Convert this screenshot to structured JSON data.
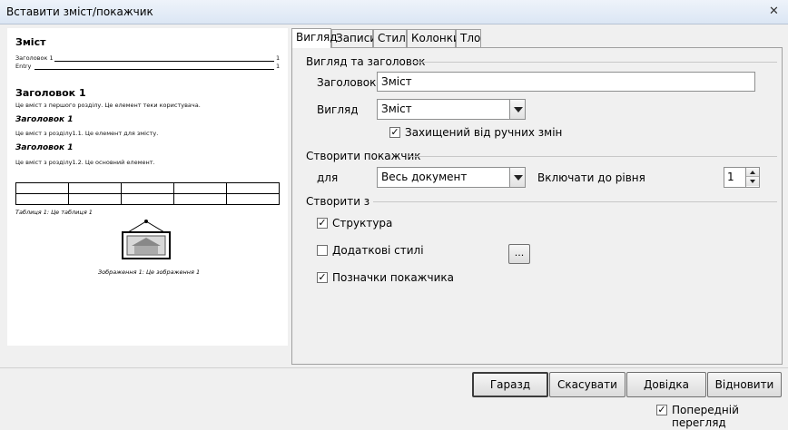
{
  "window": {
    "title": "Вставити зміст/покажчик",
    "close_glyph": "✕"
  },
  "preview": {
    "toc_title": "Зміст",
    "toc_entries": [
      {
        "label": "Заголовок 1",
        "page": "1"
      },
      {
        "label": "Entry",
        "page": "1"
      }
    ],
    "heading1": "Заголовок 1",
    "heading1_text": "Це вміст з першого розділу. Це елемент теки користувача.",
    "heading1_1": "Заголовок 1",
    "heading1_1_text": "Це вміст з розділу1.1. Це елемент для змісту.",
    "heading1_2": "Заголовок 1",
    "heading1_2_text": "Це вміст з розділу1.2. Це основний елемент.",
    "table_caption": "Таблиця 1: Це таблиця 1",
    "image_caption": "Зображення 1: Це зображення 1"
  },
  "tabs": [
    {
      "label": "Вигляд",
      "active": true
    },
    {
      "label": "Записи",
      "active": false
    },
    {
      "label": "Стилі",
      "active": false
    },
    {
      "label": "Колонки",
      "active": false
    },
    {
      "label": "Тло",
      "active": false
    }
  ],
  "type_title": {
    "section": "Вигляд та заголовок",
    "title_label": "Заголовок",
    "title_value": "Зміст",
    "type_label": "Вигляд",
    "type_value": "Зміст",
    "protected_label": "Захищений від ручних змін",
    "protected_checked": true
  },
  "create_index": {
    "section": "Створити покажчик",
    "for_label": "для",
    "for_value": "Весь документ",
    "levels_label": "Включати до рівня",
    "levels_value": "1"
  },
  "create_from": {
    "section": "Створити з",
    "outline_label": "Структура",
    "outline_checked": true,
    "styles_label": "Додаткові стилі",
    "styles_checked": false,
    "styles_button": "...",
    "marks_label": "Позначки покажчика",
    "marks_checked": true
  },
  "buttons": {
    "ok": "Гаразд",
    "cancel": "Скасувати",
    "help": "Довідка",
    "reset": "Відновити"
  },
  "preview_toggle": {
    "label": "Попередній перегляд",
    "checked": true
  },
  "check_glyph": "✓"
}
